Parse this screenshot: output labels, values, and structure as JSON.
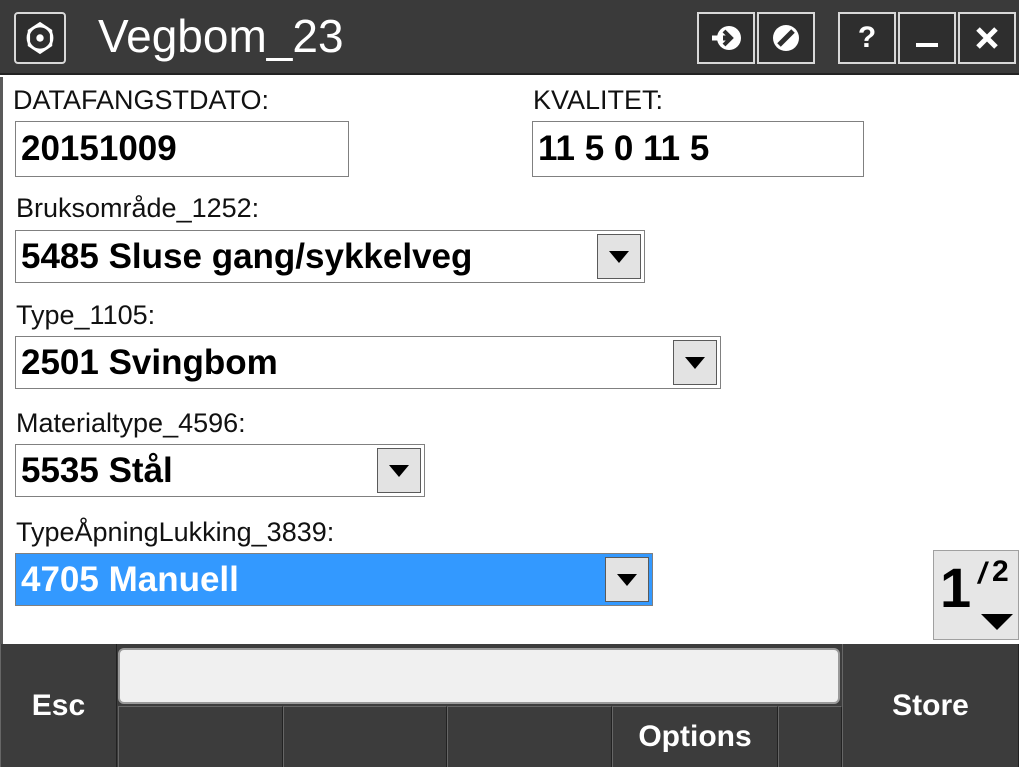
{
  "window": {
    "title": "Vegbom_23",
    "buttons": {
      "help": "?"
    }
  },
  "form": {
    "datafangstdato": {
      "label": "DATAFANGSTDATO:",
      "value": "20151009"
    },
    "kvalitet": {
      "label": "KVALITET:",
      "value": "11 5 0 11 5"
    },
    "bruksomrade": {
      "label": "Bruksområde_1252:",
      "value": "5485 Sluse gang/sykkelveg"
    },
    "type": {
      "label": "Type_1105:",
      "value": "2501 Svingbom"
    },
    "materialtype": {
      "label": "Materialtype_4596:",
      "value": "5535 Stål"
    },
    "typeapning": {
      "label": "TypeÅpningLukking_3839:",
      "value": "4705 Manuell"
    }
  },
  "pager": {
    "current": "1",
    "separator": "/",
    "total": "2"
  },
  "toolbar": {
    "esc": "Esc",
    "options": "Options",
    "store": "Store"
  },
  "colors": {
    "titlebar": "#3a3a3a",
    "toolbar": "#3c3c3c",
    "selection": "#3399ff"
  }
}
